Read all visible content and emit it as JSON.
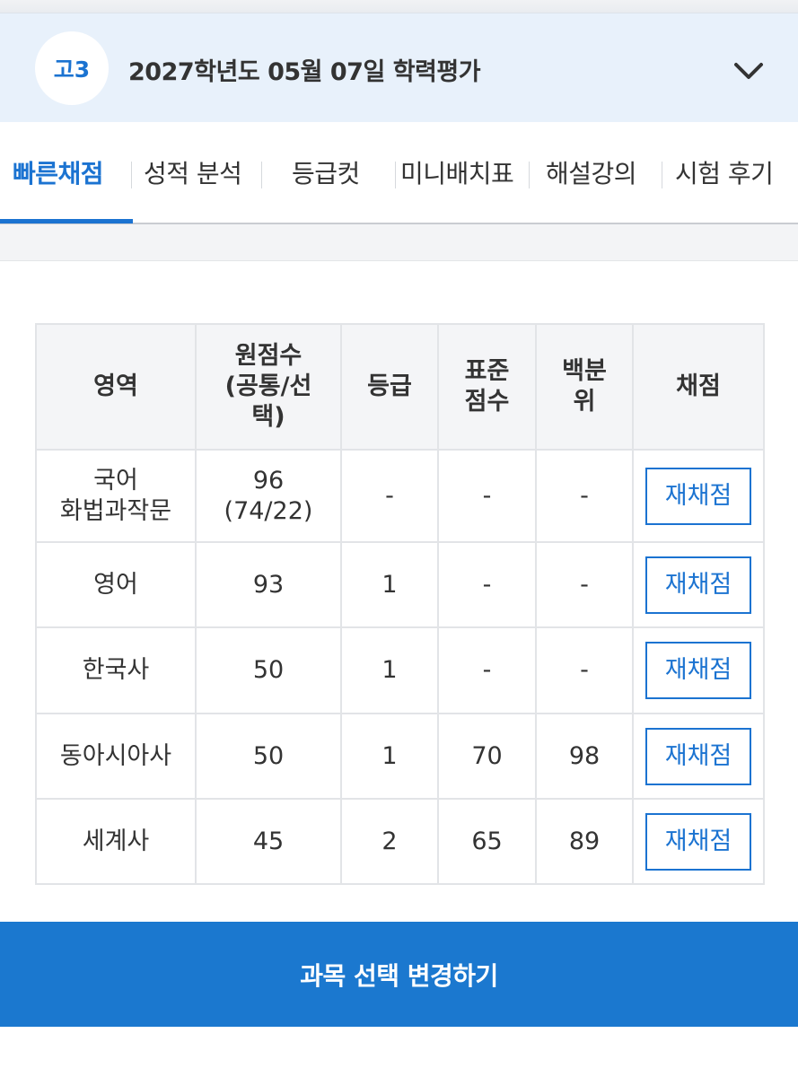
{
  "header": {
    "grade": "고3",
    "exam_title": "2027학년도 05월 07일 학력평가"
  },
  "tabs": [
    {
      "label": "빠른채점",
      "active": true
    },
    {
      "label": "성적 분석"
    },
    {
      "label": "등급컷"
    },
    {
      "label": "미니배치표"
    },
    {
      "label": "해설강의"
    },
    {
      "label": "시험 후기"
    }
  ],
  "table": {
    "headers": [
      "영역",
      "원점수\n(공통/선\n택)",
      "등급",
      "표준\n점수",
      "백분\n위",
      "채점"
    ],
    "rows": [
      {
        "subject": "국어\n화법과작문",
        "raw": "96\n(74/22)",
        "grade": "-",
        "standard": "-",
        "percentile": "-",
        "action": "재채점"
      },
      {
        "subject": "영어",
        "raw": "93",
        "grade": "1",
        "standard": "-",
        "percentile": "-",
        "action": "재채점"
      },
      {
        "subject": "한국사",
        "raw": "50",
        "grade": "1",
        "standard": "-",
        "percentile": "-",
        "action": "재채점"
      },
      {
        "subject": "동아시아사",
        "raw": "50",
        "grade": "1",
        "standard": "70",
        "percentile": "98",
        "action": "재채점"
      },
      {
        "subject": "세계사",
        "raw": "45",
        "grade": "2",
        "standard": "65",
        "percentile": "89",
        "action": "재채점"
      }
    ]
  },
  "bottom_button": "과목 선택 변경하기",
  "colors": {
    "accent": "#1b73d1",
    "header_bg": "#e8f1fb",
    "button_bg": "#1b78cf"
  }
}
